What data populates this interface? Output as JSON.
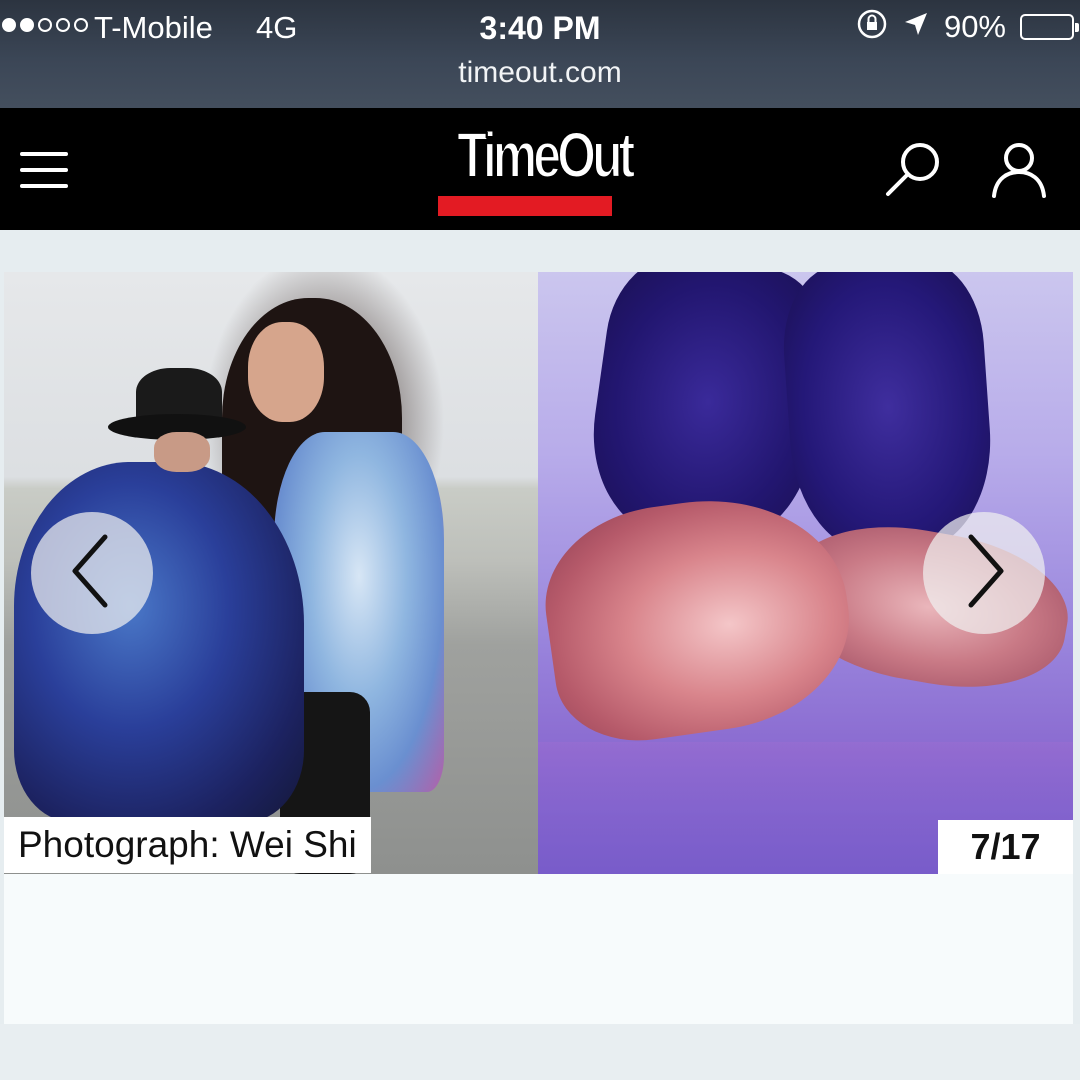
{
  "status_bar": {
    "signal_dots_filled": 2,
    "signal_dots_total": 5,
    "carrier": "T-Mobile",
    "network": "4G",
    "time": "3:40 PM",
    "battery_percent": "90%",
    "battery_level": 0.9,
    "icons": [
      "orientation-lock-icon",
      "location-arrow-icon",
      "battery-icon"
    ]
  },
  "browser": {
    "url": "timeout.com"
  },
  "header": {
    "logo_text": "TimeOut",
    "brand_colors": {
      "background": "#000000",
      "accent": "#e31b23"
    },
    "icons": [
      "menu-icon",
      "search-icon",
      "user-icon"
    ]
  },
  "gallery": {
    "credit": "Photograph: Wei Shi",
    "counter": "7/17",
    "current": 7,
    "total": 17,
    "icons": [
      "chevron-left-icon",
      "chevron-right-icon"
    ]
  }
}
